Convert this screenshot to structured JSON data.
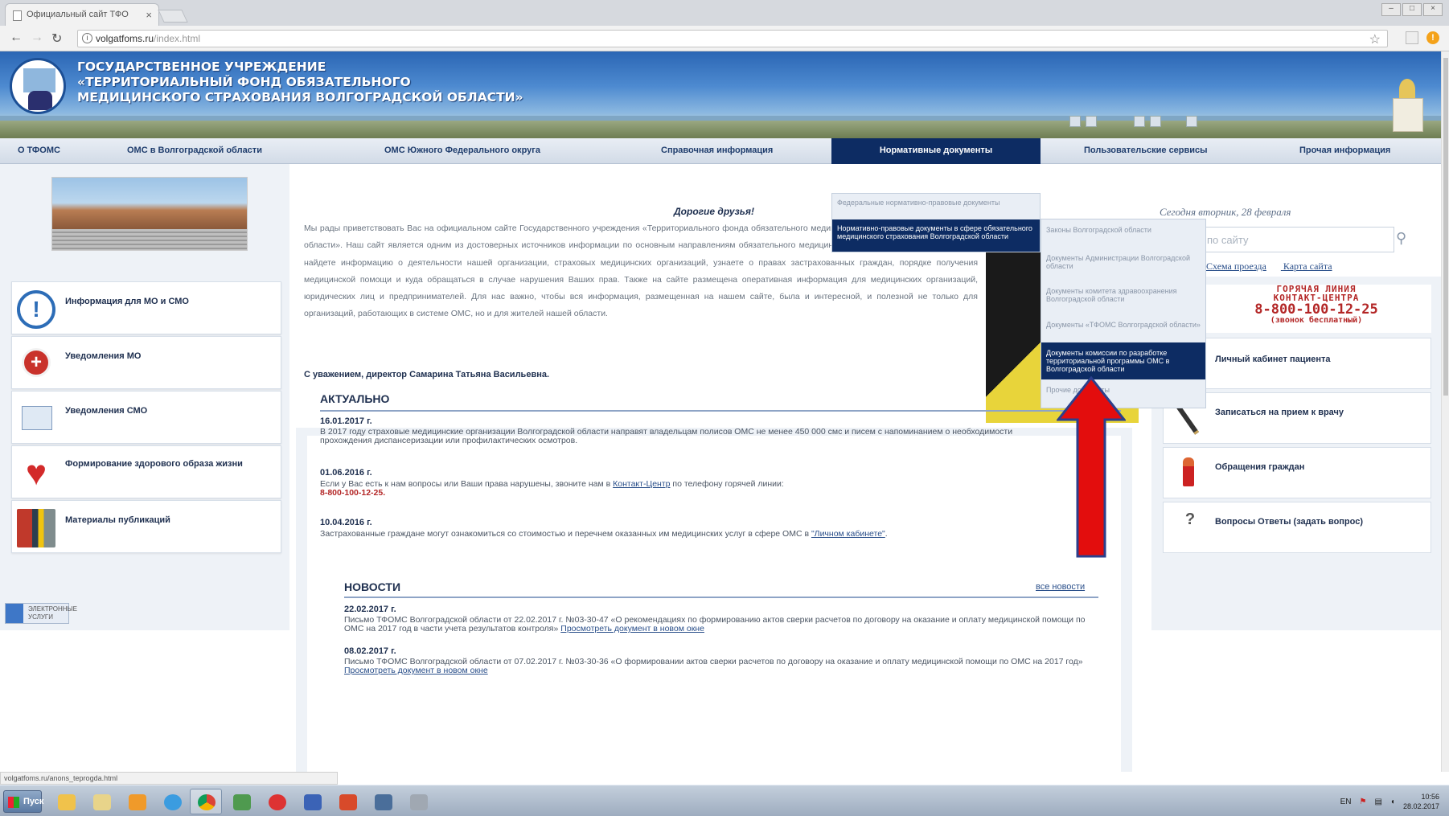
{
  "browser": {
    "tab_title": "Официальный сайт ТФО",
    "tab_close": "×",
    "url_host": "volgatfoms.ru",
    "url_path": "/index.html",
    "status_url": "volgatfoms.ru/anons_teprogda.html"
  },
  "header": {
    "title_line1": "ГОСУДАРСТВЕННОЕ УЧРЕЖДЕНИЕ",
    "title_line2": "«ТЕРРИТОРИАЛЬНЫЙ ФОНД ОБЯЗАТЕЛЬНОГО",
    "title_line3": "МЕДИЦИНСКОГО СТРАХОВАНИЯ ВОЛГОГРАДСКОЙ ОБЛАСТИ»"
  },
  "nav": [
    "О ТФОМС",
    "ОМС в Волгоградской области",
    "ОМС Южного Федерального округа",
    "Справочная информация",
    "Нормативные документы",
    "Пользовательские сервисы",
    "Прочая информация"
  ],
  "dropdown": {
    "items": [
      "Федеральные нормативно-правовые документы",
      "Нормативно-правовые документы в сфере обязательного медицинского страхования Волгоградской области"
    ],
    "submenu": [
      "Законы Волгоградской области",
      "Документы Администрации Волгоградской области",
      "Документы комитета здравоохранения Волгоградской области",
      "Документы «ТФОМС Волгоградской области»",
      "Документы комиссии по разработке территориальной программы ОМС в Волгоградской области",
      "Прочие документы"
    ]
  },
  "left_cards": [
    "Информация для МО и СМО",
    "Уведомления МО",
    "Уведомления СМО",
    "Формирование здорового образа жизни",
    "Материалы публикаций"
  ],
  "badge_text": "ЭЛЕКТРОННЫЕ УСЛУГИ",
  "welcome": {
    "greeting": "Дорогие друзья!",
    "text": "Мы рады приветствовать Вас на официальном сайте Государственного учреждения «Территориального фонда обязательного медицинского страхования Волгоградской области». Наш сайт является одним из достоверных источников информации по основным направлениям обязательного медицинского страхования. Посетив его, Вы найдете информацию о деятельности нашей организации, страховых медицинских организаций, узнаете о правах застрахованных граждан, порядке получения медицинской помощи и куда обращаться в случае нарушения Ваших прав. Также на сайте размещена оперативная информация для медицинских организаций, юридических лиц и предпринимателей. Для нас важно, чтобы вся информация, размещенная на нашем сайте, была и интересной, и полезной не только для организаций, работающих в системе ОМС, но и для жителей нашей области.",
    "signature": "С уважением, директор Самарина Татьяна Васильевна."
  },
  "right": {
    "date": "Сегодня вторник, 28 февраля",
    "search_placeholder": "по сайту",
    "link_map": "Схема проезда",
    "link_sitemap": "Карта сайта",
    "hotline_1": "ГОРЯЧАЯ ЛИНИЯ",
    "hotline_2": "КОНТАКТ-ЦЕНТРА",
    "hotline_phone": "8-800-100-12-25",
    "hotline_free": "(звонок бесплатный)",
    "cards": [
      "Личный кабинет пациента",
      "Записаться на прием к врачу",
      "Обращения граждан",
      "Вопросы Ответы (задать вопрос)"
    ]
  },
  "actual": {
    "heading": "АКТУАЛЬНО",
    "items": [
      {
        "date": "16.01.2017 г.",
        "text": "В 2017 году страховые медицинские организации Волгоградской области направят владельцам полисов ОМС не менее 450 000 смс и писем с напоминанием о необходимости прохождения диспансеризации или профилактических осмотров."
      },
      {
        "date": "01.06.2016 г.",
        "text_before": "Если у Вас есть к нам вопросы или Ваши права нарушены, звоните нам в ",
        "link": "Контакт-Центр",
        "text_after": " по телефону горячей линии:",
        "phone": "8-800-100-12-25."
      },
      {
        "date": "10.04.2016 г.",
        "text_before": "Застрахованные граждане могут ознакомиться со стоимостью и перечнем оказанных им медицинских услуг в сфере ОМС в ",
        "link": "\"Личном кабинете\"",
        "text_after": "."
      }
    ]
  },
  "news": {
    "heading": "НОВОСТИ",
    "all_link": "все новости",
    "items": [
      {
        "date": "22.02.2017 г.",
        "text": "Письмо ТФОМС Волгоградской области от 22.02.2017 г. №03-30-47 «О рекомендациях по формированию актов сверки расчетов по договору на оказание и оплату медицинской помощи по ОМС на 2017 год в части учета результатов контроля»",
        "link": "Просмотреть документ в новом окне"
      },
      {
        "date": "08.02.2017 г.",
        "text": "Письмо ТФОМС Волгоградской области от 07.02.2017 г. №03-30-36 «О формировании актов сверки расчетов по договору на оказание и оплату медицинской помощи по ОМС на 2017 год»",
        "link": "Просмотреть документ в новом окне"
      }
    ]
  },
  "taskbar": {
    "start": "Пуск",
    "lang": "EN",
    "time": "10:56",
    "date": "28.02.2017"
  }
}
